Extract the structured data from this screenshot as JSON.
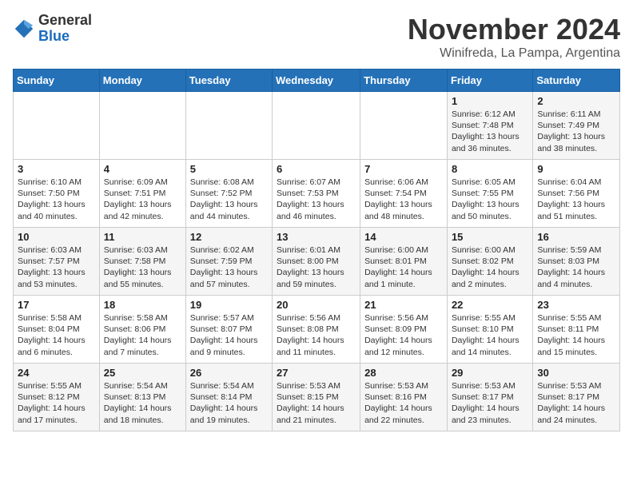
{
  "header": {
    "logo_line1": "General",
    "logo_line2": "Blue",
    "month": "November 2024",
    "location": "Winifreda, La Pampa, Argentina"
  },
  "weekdays": [
    "Sunday",
    "Monday",
    "Tuesday",
    "Wednesday",
    "Thursday",
    "Friday",
    "Saturday"
  ],
  "weeks": [
    [
      {
        "day": "",
        "info": ""
      },
      {
        "day": "",
        "info": ""
      },
      {
        "day": "",
        "info": ""
      },
      {
        "day": "",
        "info": ""
      },
      {
        "day": "",
        "info": ""
      },
      {
        "day": "1",
        "info": "Sunrise: 6:12 AM\nSunset: 7:48 PM\nDaylight: 13 hours\nand 36 minutes."
      },
      {
        "day": "2",
        "info": "Sunrise: 6:11 AM\nSunset: 7:49 PM\nDaylight: 13 hours\nand 38 minutes."
      }
    ],
    [
      {
        "day": "3",
        "info": "Sunrise: 6:10 AM\nSunset: 7:50 PM\nDaylight: 13 hours\nand 40 minutes."
      },
      {
        "day": "4",
        "info": "Sunrise: 6:09 AM\nSunset: 7:51 PM\nDaylight: 13 hours\nand 42 minutes."
      },
      {
        "day": "5",
        "info": "Sunrise: 6:08 AM\nSunset: 7:52 PM\nDaylight: 13 hours\nand 44 minutes."
      },
      {
        "day": "6",
        "info": "Sunrise: 6:07 AM\nSunset: 7:53 PM\nDaylight: 13 hours\nand 46 minutes."
      },
      {
        "day": "7",
        "info": "Sunrise: 6:06 AM\nSunset: 7:54 PM\nDaylight: 13 hours\nand 48 minutes."
      },
      {
        "day": "8",
        "info": "Sunrise: 6:05 AM\nSunset: 7:55 PM\nDaylight: 13 hours\nand 50 minutes."
      },
      {
        "day": "9",
        "info": "Sunrise: 6:04 AM\nSunset: 7:56 PM\nDaylight: 13 hours\nand 51 minutes."
      }
    ],
    [
      {
        "day": "10",
        "info": "Sunrise: 6:03 AM\nSunset: 7:57 PM\nDaylight: 13 hours\nand 53 minutes."
      },
      {
        "day": "11",
        "info": "Sunrise: 6:03 AM\nSunset: 7:58 PM\nDaylight: 13 hours\nand 55 minutes."
      },
      {
        "day": "12",
        "info": "Sunrise: 6:02 AM\nSunset: 7:59 PM\nDaylight: 13 hours\nand 57 minutes."
      },
      {
        "day": "13",
        "info": "Sunrise: 6:01 AM\nSunset: 8:00 PM\nDaylight: 13 hours\nand 59 minutes."
      },
      {
        "day": "14",
        "info": "Sunrise: 6:00 AM\nSunset: 8:01 PM\nDaylight: 14 hours\nand 1 minute."
      },
      {
        "day": "15",
        "info": "Sunrise: 6:00 AM\nSunset: 8:02 PM\nDaylight: 14 hours\nand 2 minutes."
      },
      {
        "day": "16",
        "info": "Sunrise: 5:59 AM\nSunset: 8:03 PM\nDaylight: 14 hours\nand 4 minutes."
      }
    ],
    [
      {
        "day": "17",
        "info": "Sunrise: 5:58 AM\nSunset: 8:04 PM\nDaylight: 14 hours\nand 6 minutes."
      },
      {
        "day": "18",
        "info": "Sunrise: 5:58 AM\nSunset: 8:06 PM\nDaylight: 14 hours\nand 7 minutes."
      },
      {
        "day": "19",
        "info": "Sunrise: 5:57 AM\nSunset: 8:07 PM\nDaylight: 14 hours\nand 9 minutes."
      },
      {
        "day": "20",
        "info": "Sunrise: 5:56 AM\nSunset: 8:08 PM\nDaylight: 14 hours\nand 11 minutes."
      },
      {
        "day": "21",
        "info": "Sunrise: 5:56 AM\nSunset: 8:09 PM\nDaylight: 14 hours\nand 12 minutes."
      },
      {
        "day": "22",
        "info": "Sunrise: 5:55 AM\nSunset: 8:10 PM\nDaylight: 14 hours\nand 14 minutes."
      },
      {
        "day": "23",
        "info": "Sunrise: 5:55 AM\nSunset: 8:11 PM\nDaylight: 14 hours\nand 15 minutes."
      }
    ],
    [
      {
        "day": "24",
        "info": "Sunrise: 5:55 AM\nSunset: 8:12 PM\nDaylight: 14 hours\nand 17 minutes."
      },
      {
        "day": "25",
        "info": "Sunrise: 5:54 AM\nSunset: 8:13 PM\nDaylight: 14 hours\nand 18 minutes."
      },
      {
        "day": "26",
        "info": "Sunrise: 5:54 AM\nSunset: 8:14 PM\nDaylight: 14 hours\nand 19 minutes."
      },
      {
        "day": "27",
        "info": "Sunrise: 5:53 AM\nSunset: 8:15 PM\nDaylight: 14 hours\nand 21 minutes."
      },
      {
        "day": "28",
        "info": "Sunrise: 5:53 AM\nSunset: 8:16 PM\nDaylight: 14 hours\nand 22 minutes."
      },
      {
        "day": "29",
        "info": "Sunrise: 5:53 AM\nSunset: 8:17 PM\nDaylight: 14 hours\nand 23 minutes."
      },
      {
        "day": "30",
        "info": "Sunrise: 5:53 AM\nSunset: 8:17 PM\nDaylight: 14 hours\nand 24 minutes."
      }
    ]
  ]
}
